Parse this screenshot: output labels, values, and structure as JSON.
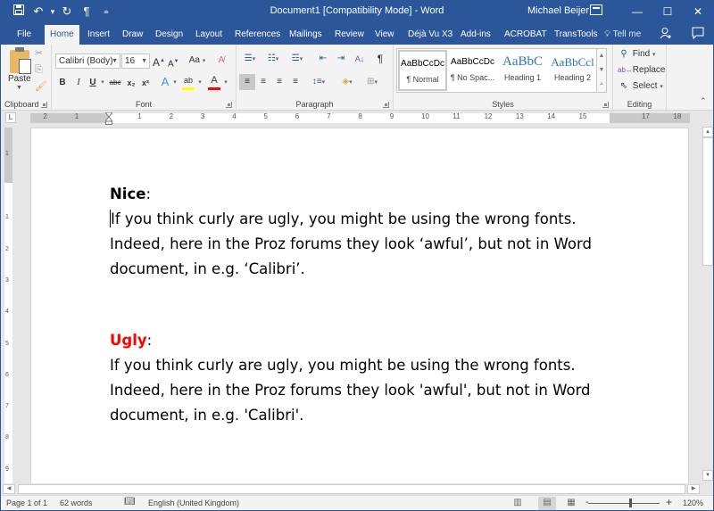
{
  "window": {
    "title": "Document1 [Compatibility Mode]  -  Word",
    "user": "Michael Beijer",
    "controls": {
      "minimize": "—",
      "maximize": "☐",
      "close": "✕"
    }
  },
  "quick_access": {
    "save_icon": "save-icon",
    "undo_icon": "undo-icon",
    "redo_icon": "redo-icon",
    "pilcrow_icon": "pilcrow-icon",
    "customize_icon": "customize-qat-icon"
  },
  "tabs": [
    {
      "label": "File"
    },
    {
      "label": "Home",
      "active": true
    },
    {
      "label": "Insert"
    },
    {
      "label": "Draw"
    },
    {
      "label": "Design"
    },
    {
      "label": "Layout"
    },
    {
      "label": "References"
    },
    {
      "label": "Mailings"
    },
    {
      "label": "Review"
    },
    {
      "label": "View"
    },
    {
      "label": "Déjà Vu X3"
    },
    {
      "label": "Add-ins"
    },
    {
      "label": "ACROBAT"
    },
    {
      "label": "TransTools"
    }
  ],
  "tell_me": "Tell me",
  "ribbon": {
    "clipboard": {
      "label": "Clipboard",
      "paste": "Paste"
    },
    "font": {
      "label": "Font",
      "font_name": "Calibri (Body)",
      "font_size": "16",
      "grow": "A",
      "shrink": "A",
      "change_case": "Aa",
      "bold": "B",
      "italic": "I",
      "underline": "U",
      "strikethrough": "abc",
      "subscript": "x₂",
      "superscript": "x²",
      "text_effects": "A",
      "highlight": "ab",
      "font_color": "A",
      "highlight_color": "#ffff00",
      "font_color_value": "#ff0000"
    },
    "paragraph": {
      "label": "Paragraph",
      "pilcrow": "¶"
    },
    "styles": {
      "label": "Styles",
      "items": [
        {
          "preview": "AaBbCcDc",
          "name": "¶ Normal",
          "selected": true
        },
        {
          "preview": "AaBbCcDc",
          "name": "¶ No Spac..."
        },
        {
          "preview": "AaBbC",
          "name": "Heading 1"
        },
        {
          "preview": "AaBbCcl",
          "name": "Heading 2"
        }
      ]
    },
    "editing": {
      "label": "Editing",
      "find": "Find",
      "replace": "Replace",
      "select": "Select"
    }
  },
  "ruler": {
    "left_numbers": [
      "2",
      "1"
    ],
    "right_numbers": [
      "1",
      "2",
      "3",
      "4",
      "5",
      "6",
      "7",
      "8",
      "9",
      "10",
      "11",
      "12",
      "13",
      "14",
      "15",
      "17",
      "18"
    ],
    "vertical_numbers": [
      "1",
      "1",
      "2",
      "3",
      "4",
      "5",
      "6",
      "7",
      "8",
      "9"
    ]
  },
  "document": {
    "sections": [
      {
        "heading": "Nice",
        "heading_color": "#000000",
        "colon": ":",
        "lines": [
          "If you think curly are ugly, you might be using the wrong fonts.",
          "Indeed, here in the Proz forums they look ‘awful’, but not in Word",
          "document, in e.g. ‘Calibri’."
        ]
      },
      {
        "heading": "Ugly",
        "heading_color": "#ff0000",
        "colon": ":",
        "lines": [
          "If you think curly are ugly, you might be using the wrong fonts.",
          "Indeed, here in the Proz forums they look 'awful', but not in Word",
          "document, in e.g. 'Calibri'."
        ]
      }
    ]
  },
  "status": {
    "page": "Page 1 of 1",
    "words": "62 words",
    "language": "English (United Kingdom)",
    "zoom_level": "120%",
    "zoom_minus": "-",
    "zoom_plus": "+"
  }
}
